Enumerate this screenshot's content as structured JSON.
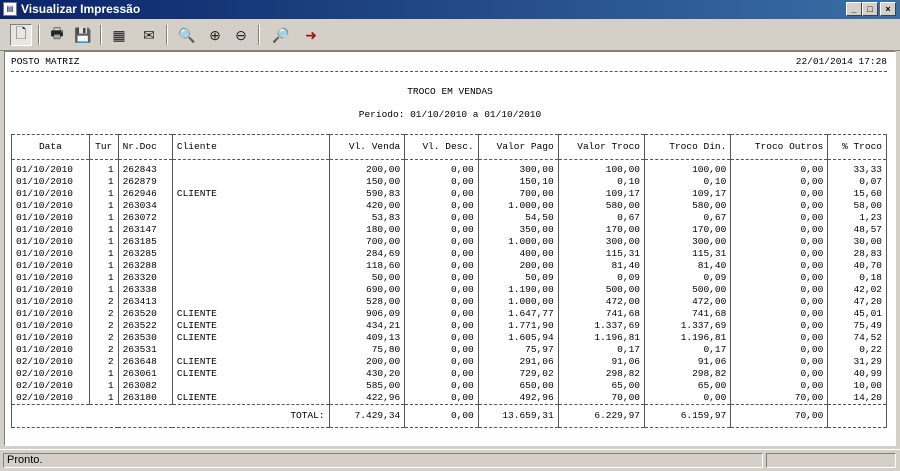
{
  "window": {
    "title": "Visualizar Impressão",
    "controls": {
      "minimize": "_",
      "maximize": "□",
      "close": "×"
    }
  },
  "toolbar": {
    "buttons": [
      {
        "icon": "page-icon",
        "glyph": "🗋"
      },
      {
        "icon": "printer-icon",
        "glyph": "🖶"
      },
      {
        "icon": "save-icon",
        "glyph": "💾"
      },
      {
        "icon": "grid-icon",
        "glyph": "▦"
      },
      {
        "icon": "mail-icon",
        "glyph": "✉"
      },
      {
        "icon": "zoom-fit-icon",
        "glyph": "🔍"
      },
      {
        "icon": "zoom-in-icon",
        "glyph": "⊕"
      },
      {
        "icon": "zoom-out-icon",
        "glyph": "⊖"
      },
      {
        "icon": "find-icon",
        "glyph": "🔎"
      },
      {
        "icon": "exit-icon",
        "glyph": "➜"
      }
    ]
  },
  "report": {
    "company": "POSTO MATRIZ",
    "datetime": "22/01/2014 17:28",
    "title": "TROCO EM VENDAS",
    "period": "Período: 01/10/2010 a 01/10/2010",
    "columns": [
      "Data",
      "Tur",
      "Nr.Doc",
      "Cliente",
      "Vl. Venda",
      "Vl. Desc.",
      "Valor Pago",
      "Valor Troco",
      "Troco Din.",
      "Troco Outros",
      "% Troco"
    ],
    "rows": [
      [
        "01/10/2010",
        "1",
        "262843",
        "",
        "200,00",
        "0,00",
        "300,00",
        "100,00",
        "100,00",
        "0,00",
        "33,33"
      ],
      [
        "01/10/2010",
        "1",
        "262879",
        "",
        "150,00",
        "0,00",
        "150,10",
        "0,10",
        "0,10",
        "0,00",
        "0,07"
      ],
      [
        "01/10/2010",
        "1",
        "262946",
        "CLIENTE",
        "590,83",
        "0,00",
        "700,00",
        "109,17",
        "109,17",
        "0,00",
        "15,60"
      ],
      [
        "01/10/2010",
        "1",
        "263034",
        "",
        "420,00",
        "0,00",
        "1.000,00",
        "580,00",
        "580,00",
        "0,00",
        "58,00"
      ],
      [
        "01/10/2010",
        "1",
        "263072",
        "",
        "53,83",
        "0,00",
        "54,50",
        "0,67",
        "0,67",
        "0,00",
        "1,23"
      ],
      [
        "01/10/2010",
        "1",
        "263147",
        "",
        "180,00",
        "0,00",
        "350,00",
        "170,00",
        "170,00",
        "0,00",
        "48,57"
      ],
      [
        "01/10/2010",
        "1",
        "263185",
        "",
        "700,00",
        "0,00",
        "1.000,00",
        "300,00",
        "300,00",
        "0,00",
        "30,00"
      ],
      [
        "01/10/2010",
        "1",
        "263285",
        "",
        "284,69",
        "0,00",
        "400,00",
        "115,31",
        "115,31",
        "0,00",
        "28,83"
      ],
      [
        "01/10/2010",
        "1",
        "263288",
        "",
        "118,60",
        "0,00",
        "200,00",
        "81,40",
        "81,40",
        "0,00",
        "40,70"
      ],
      [
        "01/10/2010",
        "1",
        "263320",
        "",
        "50,00",
        "0,00",
        "50,09",
        "0,09",
        "0,09",
        "0,00",
        "0,18"
      ],
      [
        "01/10/2010",
        "1",
        "263338",
        "",
        "690,00",
        "0,00",
        "1.190,00",
        "500,00",
        "500,00",
        "0,00",
        "42,02"
      ],
      [
        "01/10/2010",
        "2",
        "263413",
        "",
        "528,00",
        "0,00",
        "1.000,00",
        "472,00",
        "472,00",
        "0,00",
        "47,20"
      ],
      [
        "01/10/2010",
        "2",
        "263520",
        "CLIENTE",
        "906,09",
        "0,00",
        "1.647,77",
        "741,68",
        "741,68",
        "0,00",
        "45,01"
      ],
      [
        "01/10/2010",
        "2",
        "263522",
        "CLIENTE",
        "434,21",
        "0,00",
        "1.771,90",
        "1.337,69",
        "1.337,69",
        "0,00",
        "75,49"
      ],
      [
        "01/10/2010",
        "2",
        "263530",
        "CLIENTE",
        "409,13",
        "0,00",
        "1.605,94",
        "1.196,81",
        "1.196,81",
        "0,00",
        "74,52"
      ],
      [
        "01/10/2010",
        "2",
        "263531",
        "",
        "75,80",
        "0,00",
        "75,97",
        "0,17",
        "0,17",
        "0,00",
        "0,22"
      ],
      [
        "02/10/2010",
        "2",
        "263648",
        "CLIENTE",
        "200,00",
        "0,00",
        "291,06",
        "91,06",
        "91,06",
        "0,00",
        "31,29"
      ],
      [
        "02/10/2010",
        "1",
        "263061",
        "CLIENTE",
        "430,20",
        "0,00",
        "729,02",
        "298,82",
        "298,82",
        "0,00",
        "40,99"
      ],
      [
        "02/10/2010",
        "1",
        "263082",
        "",
        "585,00",
        "0,00",
        "650,00",
        "65,00",
        "65,00",
        "0,00",
        "10,00"
      ],
      [
        "02/10/2010",
        "1",
        "263180",
        "CLIENTE",
        "422,96",
        "0,00",
        "492,96",
        "70,00",
        "0,00",
        "70,00",
        "14,20"
      ]
    ],
    "total": {
      "label": "TOTAL:",
      "venda": "7.429,34",
      "desc": "0,00",
      "pago": "13.659,31",
      "troco": "6.229,97",
      "din": "6.159,97",
      "outros": "70,00",
      "pct": ""
    }
  },
  "status": {
    "text": "Pronto."
  }
}
